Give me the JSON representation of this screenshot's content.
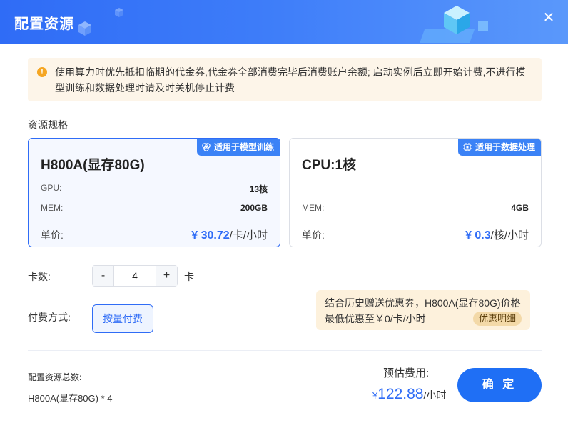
{
  "header": {
    "title": "配置资源",
    "close_symbol": "✕"
  },
  "notice": {
    "icon": "warning-icon",
    "text": "使用算力时优先抵扣临期的代金券,代金券全部消费完毕后消费账户余额; 启动实例后立即开始计费,不进行模型训练和数据处理时请及时关机停止计费"
  },
  "resource_spec": {
    "label": "资源规格",
    "cards": [
      {
        "tag": "适用于模型训练",
        "tag_icon": "brain-icon",
        "title": "H800A(显存80G)",
        "gpu_label": "GPU:",
        "gpu_value": "13核",
        "mem_label": "MEM:",
        "mem_value": "200GB",
        "price_label": "单价:",
        "price_amount": "¥ 30.72",
        "price_unit": "/卡/小时",
        "selected": true
      },
      {
        "tag": "适用于数据处理",
        "tag_icon": "chip-icon",
        "title": "CPU:1核",
        "mem_label": "MEM:",
        "mem_value": "4GB",
        "price_label": "单价:",
        "price_amount": "¥ 0.3",
        "price_unit": "/核/小时",
        "selected": false
      }
    ]
  },
  "quantity": {
    "label": "卡数:",
    "minus": "-",
    "value": "4",
    "plus": "+",
    "unit": "卡"
  },
  "payment": {
    "label": "付费方式:",
    "option": "按量付费"
  },
  "discount": {
    "line1": "结合历史赠送优惠券，H800A(显存80G)价格",
    "line2": "最低优惠至￥0/卡/小时",
    "link": "优惠明细"
  },
  "footer": {
    "total_label": "配置资源总数:",
    "total_value": "H800A(显存80G) * 4",
    "estimate_label": "预估费用:",
    "estimate_currency": "¥",
    "estimate_amount": "122.88",
    "estimate_unit": "/小时",
    "confirm": "确 定"
  },
  "colors": {
    "primary": "#2f6cf6",
    "warning": "#f5a623",
    "notice_bg": "#fdf5e9",
    "discount_bg": "#fdf1dc"
  }
}
